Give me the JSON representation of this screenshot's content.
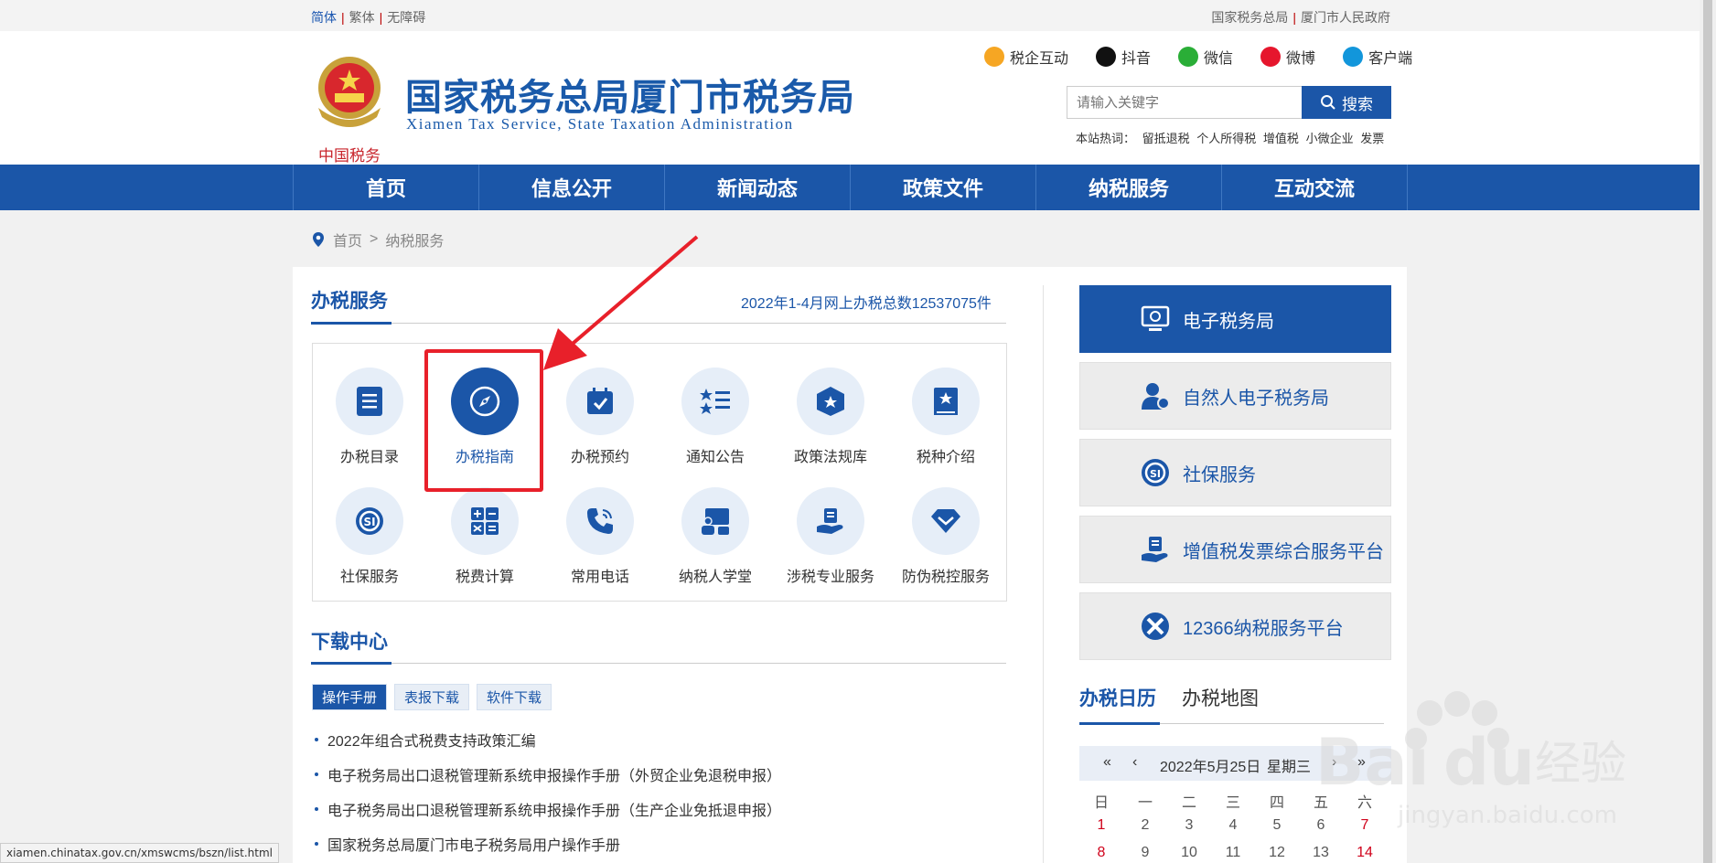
{
  "topbar": {
    "left": [
      "简体",
      "繁体",
      "无障碍"
    ],
    "right": [
      "国家税务总局",
      "厦门市人民政府"
    ]
  },
  "header": {
    "title": "国家税务总局厦门市税务局",
    "subtitle": "Xiamen Tax Service, State Taxation Administration",
    "emblem_text": "中国税务",
    "social": [
      "税企互动",
      "抖音",
      "微信",
      "微博",
      "客户端"
    ],
    "search": {
      "placeholder": "请输入关键字",
      "button": "搜索"
    },
    "hot_label": "本站热词：",
    "hot_words": [
      "留抵退税",
      "个人所得税",
      "增值税",
      "小微企业",
      "发票"
    ]
  },
  "nav": [
    "首页",
    "信息公开",
    "新闻动态",
    "政策文件",
    "纳税服务",
    "互动交流"
  ],
  "breadcrumb": {
    "home": "首页",
    "sep": ">",
    "current": "纳税服务"
  },
  "service": {
    "title": "办税服务",
    "stat": "2022年1-4月网上办税总数12537075件",
    "items": [
      "办税目录",
      "办税指南",
      "办税预约",
      "通知公告",
      "政策法规库",
      "税种介绍",
      "社保服务",
      "税费计算",
      "常用电话",
      "纳税人学堂",
      "涉税专业服务",
      "防伪税控服务"
    ],
    "highlighted": "办税指南"
  },
  "download": {
    "title": "下载中心",
    "tabs": [
      "操作手册",
      "表报下载",
      "软件下载"
    ],
    "items": [
      "2022年组合式税费支持政策汇编",
      "电子税务局出口退税管理新系统申报操作手册（外贸企业免退税申报）",
      "电子税务局出口退税管理新系统申报操作手册（生产企业免抵退申报）",
      "国家税务总局厦门市电子税务局用户操作手册"
    ]
  },
  "right_buttons": [
    "电子税务局",
    "自然人电子税务局",
    "社保服务",
    "增值税发票综合服务平台",
    "12366纳税服务平台"
  ],
  "calendar": {
    "tabs": [
      "办税日历",
      "办税地图"
    ],
    "prev_year": "«",
    "prev": "‹",
    "date": "2022年5月25日",
    "weekday": "星期三",
    "next": "›",
    "next_year": "»",
    "weekdays": [
      "日",
      "一",
      "二",
      "三",
      "四",
      "五",
      "六"
    ],
    "week1": [
      "1",
      "2",
      "3",
      "4",
      "5",
      "6",
      "7"
    ],
    "week2": [
      "8",
      "9",
      "10",
      "11",
      "12",
      "13",
      "14"
    ]
  },
  "status_url": "xiamen.chinatax.gov.cn/xmswcms/bszn/list.html",
  "watermark": {
    "brand": "Bai",
    "brand2": "du",
    "text": "经验",
    "url": "jingyan.baidu.com"
  },
  "colors": {
    "primary": "#1b56a8",
    "highlight": "#e8202a"
  }
}
